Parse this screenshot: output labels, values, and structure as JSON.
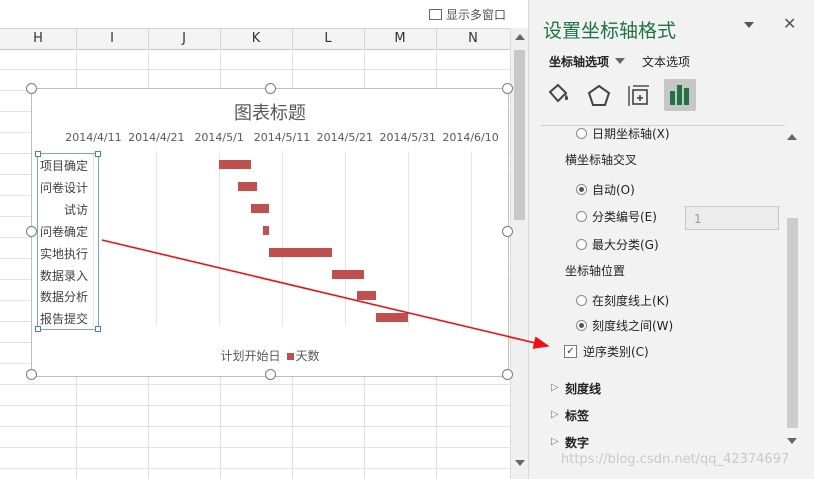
{
  "sheet": {
    "show_multi_window": "显示多窗口",
    "columns": [
      "H",
      "I",
      "J",
      "K",
      "L",
      "M",
      "N"
    ]
  },
  "chart": {
    "title": "图表标题",
    "legend": {
      "series1": "计划开始日",
      "series2": "天数"
    }
  },
  "chart_data": {
    "type": "bar",
    "orientation": "horizontal-stacked",
    "title": "图表标题",
    "x_tick_labels": [
      "2014/4/11",
      "2014/4/21",
      "2014/5/1",
      "2014/5/11",
      "2014/5/21",
      "2014/5/31",
      "2014/6/10"
    ],
    "xlim": [
      "2014/4/6",
      "2014/6/15"
    ],
    "categories": [
      "项目确定",
      "问卷设计",
      "试访",
      "问卷确定",
      "实地执行",
      "数据录入",
      "数据分析",
      "报告提交"
    ],
    "series": [
      {
        "name": "计划开始日",
        "visible": false,
        "values": [
          "2014/5/1",
          "2014/5/4",
          "2014/5/6",
          "2014/5/8",
          "2014/5/9",
          "2014/5/19",
          "2014/5/23",
          "2014/5/26"
        ]
      },
      {
        "name": "天数",
        "color": "#c0504d",
        "values": [
          5,
          3,
          3,
          1,
          10,
          5,
          3,
          5
        ]
      }
    ],
    "grid": true,
    "legend_position": "bottom"
  },
  "pane": {
    "title": "设置坐标轴格式",
    "tab_axis": "坐标轴选项",
    "tab_text": "文本选项",
    "date_axis": "日期坐标轴(X)",
    "cross_label": "横坐标轴交叉",
    "auto": "自动(O)",
    "cat_number": "分类编号(E)",
    "cat_number_value": "1",
    "max_cat": "最大分类(G)",
    "pos_label": "坐标轴位置",
    "on_ticks": "在刻度线上(K)",
    "between_ticks": "刻度线之间(W)",
    "reverse": "逆序类别(C)",
    "tick_marks": "刻度线",
    "labels": "标签",
    "number": "数字",
    "watermark": "https://blog.csdn.net/qq_42374697"
  }
}
